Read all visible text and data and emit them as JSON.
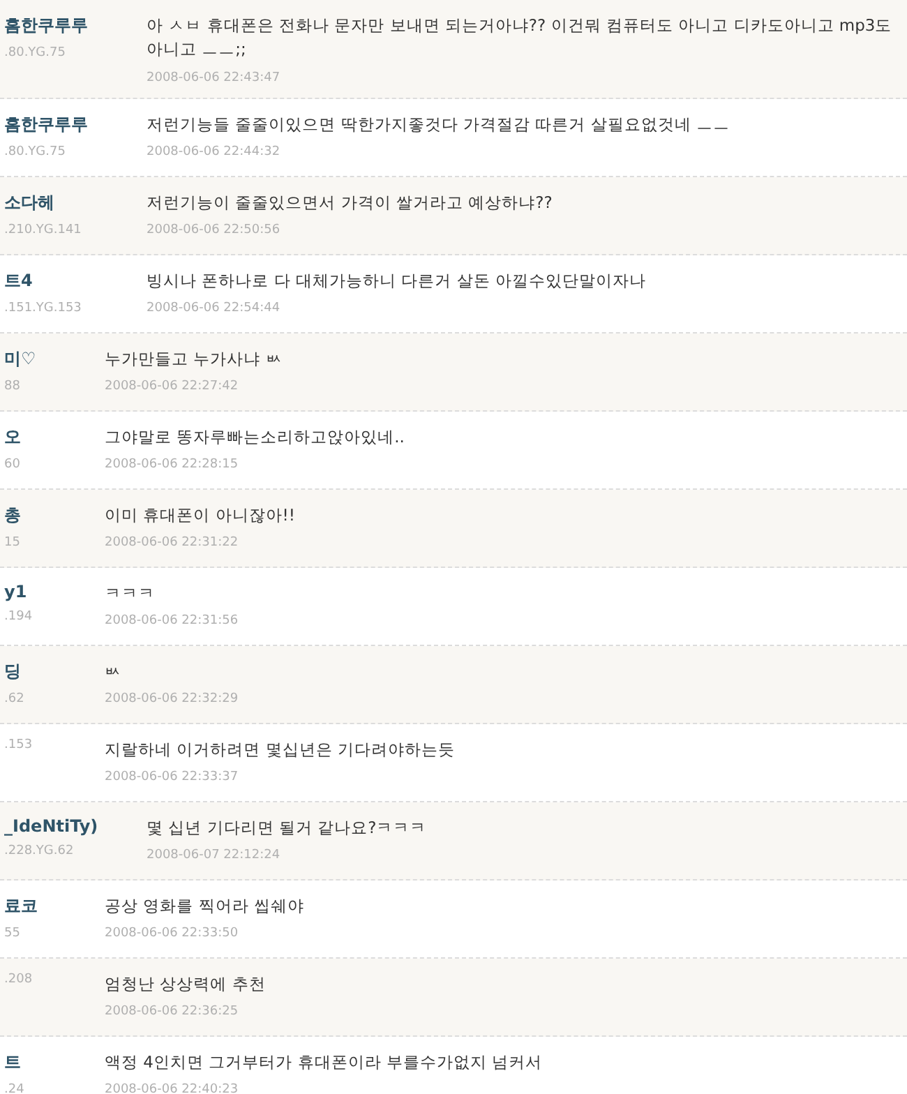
{
  "comments": [
    {
      "kind": "wide",
      "shaded": true,
      "author": "흠한쿠루루",
      "ip": ".80.YG.75",
      "message": "아 ㅅㅂ 휴대폰은 전화나 문자만 보내면 되는거아냐?? 이건뭐 컴퓨터도 아니고 디카도아니고 mp3도아니고 ㅡㅡ;;",
      "date": "2008-06-06 22:43:47"
    },
    {
      "kind": "wide",
      "shaded": false,
      "author": "흠한쿠루루",
      "ip": ".80.YG.75",
      "message": "저런기능들 줄줄이있으면 딱한가지좋것다 가격절감 따른거 살필요없것네 ㅡㅡ",
      "date": "2008-06-06 22:44:32"
    },
    {
      "kind": "wide",
      "shaded": true,
      "author": "소다헤",
      "ip": ".210.YG.141",
      "message": "저런기능이 줄줄있으면서 가격이 쌀거라고 예상하냐??",
      "date": "2008-06-06 22:50:56"
    },
    {
      "kind": "wide",
      "shaded": false,
      "author": "트4",
      "ip": ".151.YG.153",
      "message": "빙시나 폰하나로 다 대체가능하니 다른거 살돈 아낄수있단말이자나",
      "date": "2008-06-06 22:54:44"
    },
    {
      "kind": "narrow",
      "shaded": true,
      "author": "미♡",
      "ip": "88",
      "message": "누가만들고 누가사냐 ㅄ",
      "date": "2008-06-06 22:27:42"
    },
    {
      "kind": "narrow",
      "shaded": false,
      "author": "오",
      "ip": "60",
      "message": "그야말로 똥자루빠는소리하고앉아있네..",
      "date": "2008-06-06 22:28:15"
    },
    {
      "kind": "narrow",
      "shaded": true,
      "author": "총",
      "ip": "15",
      "message": "이미 휴대폰이 아니잖아!!",
      "date": "2008-06-06 22:31:22"
    },
    {
      "kind": "narrow",
      "shaded": false,
      "author": "y1",
      "ip": ".194",
      "message": "ㅋㅋㅋ",
      "date": "2008-06-06 22:31:56"
    },
    {
      "kind": "narrow",
      "shaded": true,
      "author": "딩",
      "ip": ".62",
      "message": "ㅄ",
      "date": "2008-06-06 22:32:29"
    },
    {
      "kind": "narrow",
      "shaded": false,
      "ip": ".153",
      "message": "지랄하네 이거하려면 몇십년은 기다려야하는듯",
      "date": "2008-06-06 22:33:37"
    },
    {
      "kind": "wide",
      "shaded": true,
      "author": "_IdeNtiTy)",
      "ip": ".228.YG.62",
      "message": "몇 십년 기다리면 될거 같나요?ㅋㅋㅋ",
      "date": "2008-06-07 22:12:24"
    },
    {
      "kind": "narrow",
      "shaded": false,
      "author": "료코",
      "ip": "55",
      "message": "공상 영화를 찍어라 씹쉐야",
      "date": "2008-06-06 22:33:50"
    },
    {
      "kind": "narrow",
      "shaded": true,
      "ip": ".208",
      "message": "엄청난 상상력에 추천",
      "date": "2008-06-06 22:36:25"
    },
    {
      "kind": "narrow",
      "shaded": false,
      "author": "트",
      "ip": ".24",
      "message": "액정 4인치면 그거부터가 휴대폰이라 부를수가없지 넘커서",
      "date": "2008-06-06 22:40:23"
    }
  ]
}
